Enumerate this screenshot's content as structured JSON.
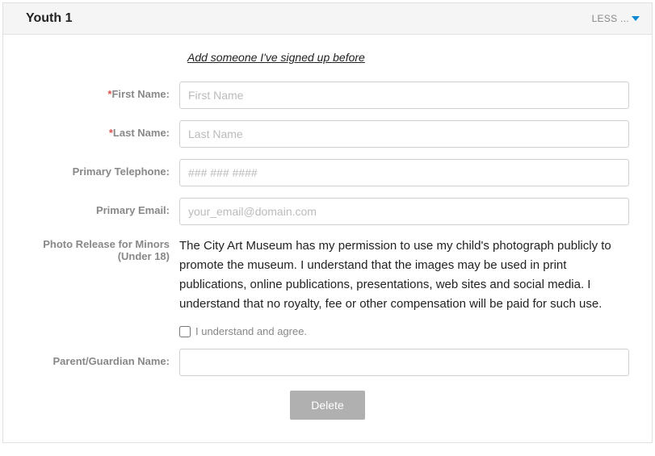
{
  "header": {
    "title": "Youth 1",
    "toggle_label": "LESS ..."
  },
  "add_someone_link": "Add someone I've signed up before",
  "fields": {
    "first_name": {
      "label": "First Name:",
      "placeholder": "First Name",
      "required": true
    },
    "last_name": {
      "label": "Last Name:",
      "placeholder": "Last Name",
      "required": true
    },
    "phone": {
      "label": "Primary Telephone:",
      "placeholder": "### ### ####",
      "required": false
    },
    "email": {
      "label": "Primary Email:",
      "placeholder": "your_email@domain.com",
      "required": false
    },
    "photo_release": {
      "label": "Photo Release for Minors (Under 18)",
      "text": "The City Art Museum has my permission to use my child's photograph publicly to promote the museum. I understand that the images may be used in print publications, online publications, presentations, web sites and social media. I understand that no royalty, fee or other compensation will be paid for such use.",
      "checkbox_label": "I understand and agree."
    },
    "guardian": {
      "label": "Parent/Guardian Name:",
      "placeholder": ""
    }
  },
  "buttons": {
    "delete": "Delete"
  }
}
